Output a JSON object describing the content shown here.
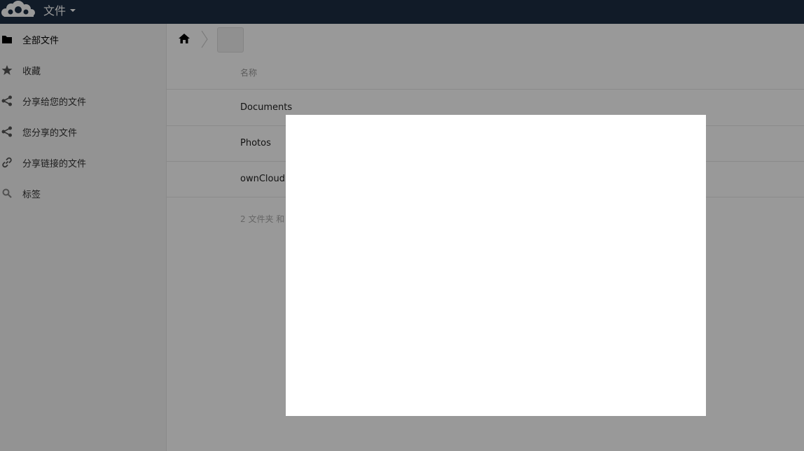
{
  "header": {
    "app_title": "文件",
    "logo_icon": "owncloud-logo-icon",
    "bg_color": "#1d2d44"
  },
  "sidebar": {
    "items": [
      {
        "label": "全部文件",
        "icon": "folder-icon",
        "active": true
      },
      {
        "label": "收藏",
        "icon": "star-icon"
      },
      {
        "label": "分享给您的文件",
        "icon": "share-icon"
      },
      {
        "label": "您分享的文件",
        "icon": "share-icon"
      },
      {
        "label": "分享链接的文件",
        "icon": "link-icon"
      },
      {
        "label": "标签",
        "icon": "search-icon"
      }
    ]
  },
  "main": {
    "breadcrumb": {
      "home_icon": "home-icon"
    },
    "column_name": "名称",
    "files": [
      {
        "name": "Documents"
      },
      {
        "name": "Photos"
      },
      {
        "name": "ownCloud"
      }
    ],
    "summary": "2 文件夹 和"
  }
}
